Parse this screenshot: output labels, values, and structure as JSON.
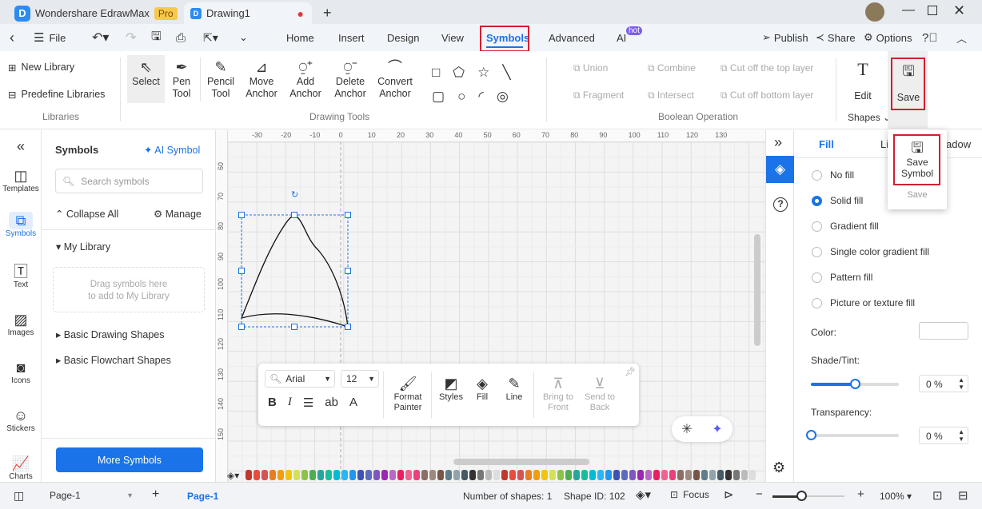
{
  "titlebar": {
    "app_name": "Wondershare EdrawMax",
    "pro_badge": "Pro",
    "doc_tab": "Drawing1",
    "new_tab": "+"
  },
  "menubar": {
    "file": "File",
    "tabs": [
      "Home",
      "Insert",
      "Design",
      "View",
      "Symbols",
      "Advanced",
      "AI"
    ],
    "active_tab": "Symbols",
    "hot_badge": "hot",
    "publish": "Publish",
    "share": "Share",
    "options": "Options"
  },
  "ribbon": {
    "libraries": {
      "new_library": "New Library",
      "predefine": "Predefine Libraries",
      "group": "Libraries"
    },
    "tools": [
      {
        "l1": "Select",
        "l2": ""
      },
      {
        "l1": "Pen",
        "l2": "Tool"
      },
      {
        "l1": "Pencil",
        "l2": "Tool"
      },
      {
        "l1": "Move",
        "l2": "Anchor"
      },
      {
        "l1": "Add",
        "l2": "Anchor"
      },
      {
        "l1": "Delete",
        "l2": "Anchor"
      },
      {
        "l1": "Convert",
        "l2": "Anchor"
      }
    ],
    "drawing_group": "Drawing Tools",
    "boolean": [
      "Union",
      "Combine",
      "Cut off the top layer",
      "Fragment",
      "Intersect",
      "Cut off bottom layer"
    ],
    "boolean_group": "Boolean Operation",
    "edit": "Edit",
    "shapes": "Shapes",
    "save": "Save"
  },
  "dropdown": {
    "save_symbol_l1": "Save",
    "save_symbol_l2": "Symbol",
    "footer": "Save"
  },
  "sidebar": {
    "items": [
      "Templates",
      "Symbols",
      "Text",
      "Images",
      "Icons",
      "Stickers",
      "Charts"
    ],
    "active": "Symbols"
  },
  "symbols_panel": {
    "title": "Symbols",
    "ai_symbol": "AI Symbol",
    "search_placeholder": "Search symbols",
    "collapse_all": "Collapse All",
    "manage": "Manage",
    "my_library": "My Library",
    "drop_hint_1": "Drag symbols here",
    "drop_hint_2": "to add to My Library",
    "libraries": [
      "Basic Drawing Shapes",
      "Basic Flowchart Shapes"
    ],
    "more_symbols": "More Symbols"
  },
  "ruler": {
    "top": [
      "-30",
      "-20",
      "-10",
      "0",
      "10",
      "20",
      "30",
      "40",
      "50",
      "60",
      "70",
      "80",
      "90",
      "100",
      "110",
      "120",
      "130"
    ],
    "left": [
      "60",
      "70",
      "80",
      "90",
      "100",
      "110",
      "120",
      "130",
      "140",
      "150"
    ]
  },
  "float_toolbar": {
    "font": "Arial",
    "size": "12",
    "format_painter_1": "Format",
    "format_painter_2": "Painter",
    "styles": "Styles",
    "fill": "Fill",
    "line": "Line",
    "bring_front_1": "Bring to",
    "bring_front_2": "Front",
    "send_back_1": "Send to",
    "send_back_2": "Back"
  },
  "right_panel": {
    "tabs": [
      "Fill",
      "Li",
      "adow"
    ],
    "active_tab": "Fill",
    "fill_options": [
      "No fill",
      "Solid fill",
      "Gradient fill",
      "Single color gradient fill",
      "Pattern fill",
      "Picture or texture fill"
    ],
    "selected_fill": "Solid fill",
    "color_label": "Color:",
    "shade_label": "Shade/Tint:",
    "shade_value": "0 %",
    "shade_fraction": 0.5,
    "transparency_label": "Transparency:",
    "transparency_value": "0 %",
    "transparency_fraction": 0
  },
  "palette": [
    "#c0392b",
    "#e74c3c",
    "#d35454",
    "#e67e22",
    "#f39c12",
    "#f1c40f",
    "#d4e157",
    "#8bc34a",
    "#4caf50",
    "#26a69a",
    "#1abc9c",
    "#00bcd4",
    "#29b6f6",
    "#2196f3",
    "#3f51b5",
    "#5c6bc0",
    "#7e57c2",
    "#9c27b0",
    "#ba68c8",
    "#e91e63",
    "#f06292",
    "#ec407a",
    "#8d6e63",
    "#a1887f",
    "#795548",
    "#607d8b",
    "#90a4ae",
    "#455a64",
    "#333333",
    "#777777",
    "#bbbbbb",
    "#dddddd"
  ],
  "statusbar": {
    "page_select": "Page-1",
    "add_page": "+",
    "page_tab": "Page-1",
    "shapes_count": "Number of shapes: 1",
    "shape_id": "Shape ID: 102",
    "focus": "Focus",
    "zoom": "100%",
    "zoom_fraction": 0.4
  }
}
